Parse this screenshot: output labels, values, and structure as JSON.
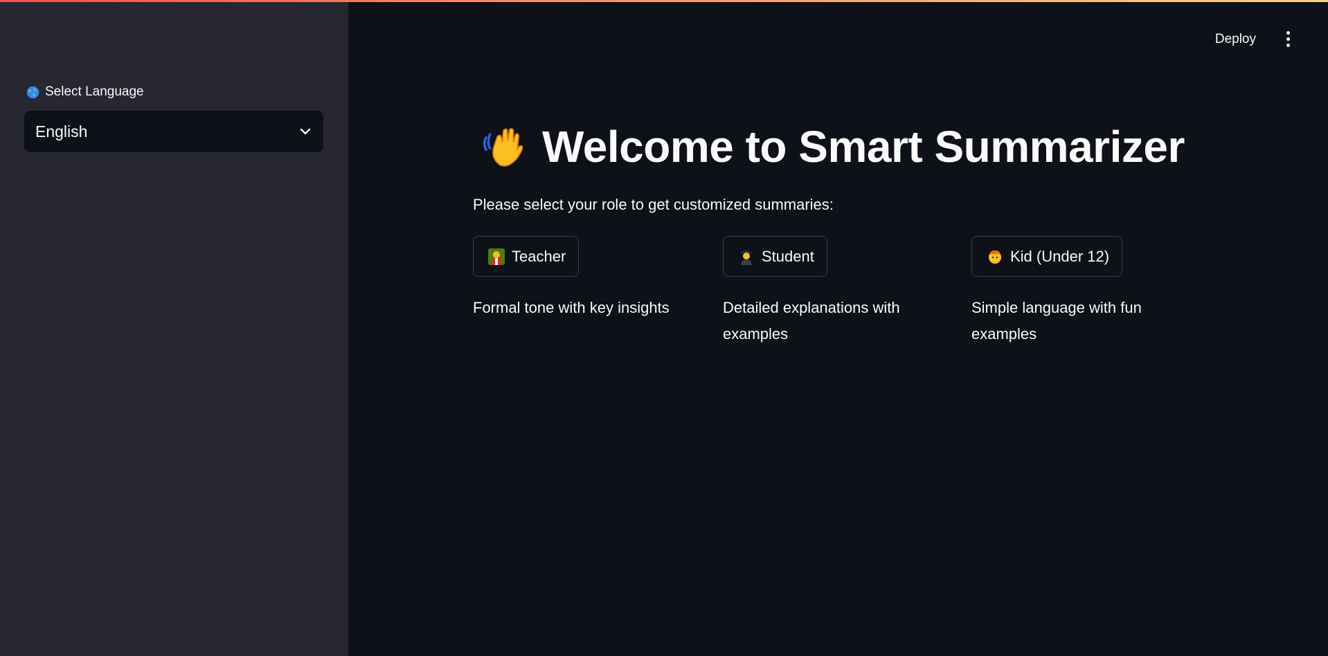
{
  "sidebar": {
    "language_label": "Select Language",
    "language_icon": "globe-icon",
    "language_selected": "English"
  },
  "header": {
    "deploy_label": "Deploy",
    "menu_icon": "vertical-dots-icon"
  },
  "main": {
    "title_icon": "waving-hand-icon",
    "title": "Welcome to Smart Summarizer",
    "subtitle": "Please select your role to get customized summaries:",
    "roles": [
      {
        "icon": "teacher-icon",
        "label": "Teacher",
        "description": "Formal tone with key insights"
      },
      {
        "icon": "student-icon",
        "label": "Student",
        "description": "Detailed explanations with examples"
      },
      {
        "icon": "kid-icon",
        "label": "Kid (Under 12)",
        "description": "Simple language with fun examples"
      }
    ]
  },
  "colors": {
    "background": "#0e1117",
    "sidebar": "#262730",
    "text": "#fafafa",
    "border": "#3c3f4a",
    "accent_start": "#ff4b4b",
    "accent_end": "#ffd27a"
  }
}
